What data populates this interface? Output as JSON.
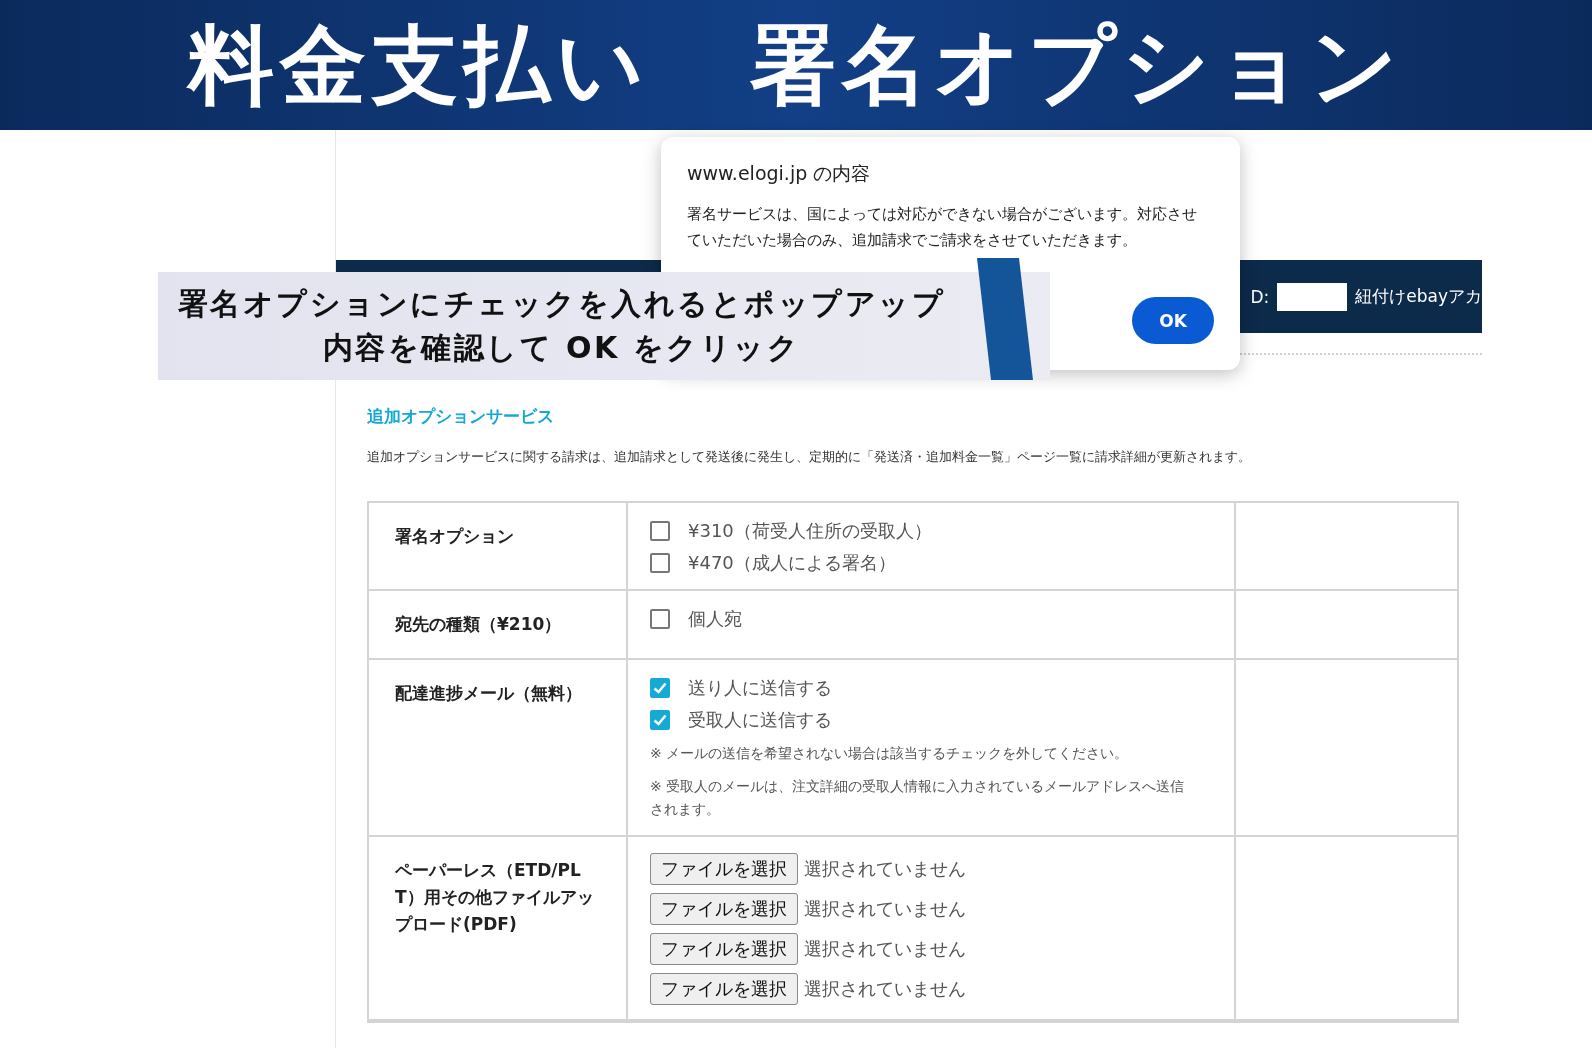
{
  "header": {
    "title_left": "料金支払い",
    "title_right": "署名オプション"
  },
  "account_bar": {
    "id_label": "D:",
    "account_label": "紐付けebayアカ"
  },
  "section": {
    "title": "追加オプションサービス",
    "description": "追加オプションサービスに関する請求は、追加請求として発送後に発生し、定期的に「発送済・追加料金一覧」ページ一覧に請求詳細が更新されます。"
  },
  "table": {
    "rows": [
      {
        "label": "署名オプション",
        "kind": "checkboxes",
        "options": [
          {
            "label": "¥310（荷受人住所の受取人）",
            "checked": false
          },
          {
            "label": "¥470（成人による署名）",
            "checked": false
          }
        ]
      },
      {
        "label": "宛先の種類（¥210）",
        "kind": "checkboxes",
        "options": [
          {
            "label": "個人宛",
            "checked": false
          }
        ]
      },
      {
        "label": "配達進捗メール（無料）",
        "kind": "checkboxes",
        "options": [
          {
            "label": "送り人に送信する",
            "checked": true
          },
          {
            "label": "受取人に送信する",
            "checked": true
          }
        ],
        "notes": [
          "※ メールの送信を希望されない場合は該当するチェックを外してください。",
          "※ 受取人のメールは、注文詳細の受取人情報に入力されているメールアドレスへ送信されます。"
        ]
      },
      {
        "label": "ペーパーレス（ETD/PLT）用その他ファイルアップロード(PDF)",
        "kind": "files",
        "files": [
          {
            "button": "ファイルを選択",
            "status": "選択されていません"
          },
          {
            "button": "ファイルを選択",
            "status": "選択されていません"
          },
          {
            "button": "ファイルを選択",
            "status": "選択されていません"
          },
          {
            "button": "ファイルを選択",
            "status": "選択されていません"
          }
        ]
      }
    ]
  },
  "dialog": {
    "title": "www.elogi.jp の内容",
    "message": "署名サービスは、国によっては対応ができない場合がございます。対応させていただいた場合のみ、追加請求でご請求をさせていただきます。",
    "ok": "OK"
  },
  "callout": {
    "lines": [
      "署名オプションにチェックを入れるとポップアップ",
      "内容を確認して OK をクリック"
    ]
  }
}
